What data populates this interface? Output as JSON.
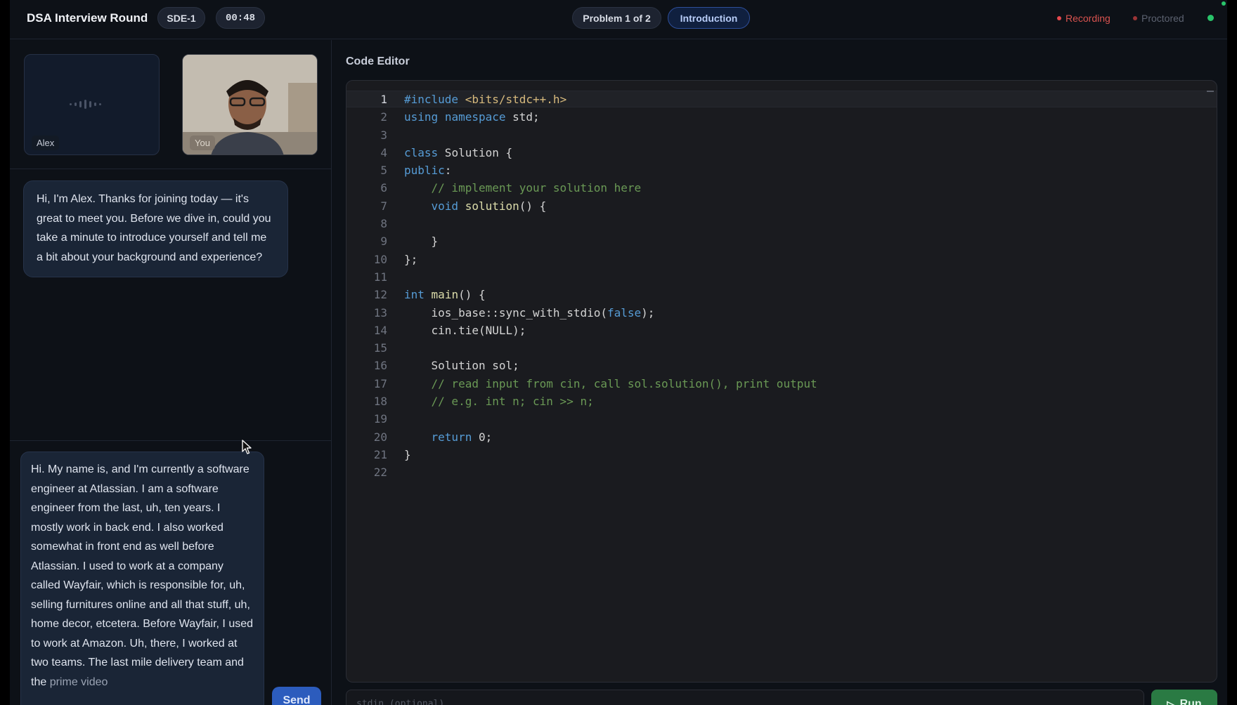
{
  "header": {
    "title": "DSA Interview Round",
    "level": "SDE-1",
    "timer": "00:48",
    "problem": "Problem 1 of 2",
    "phase": "Introduction",
    "recording": "Recording",
    "proctored": "Proctored"
  },
  "participants": {
    "interviewer": "Alex",
    "self": "You"
  },
  "chat": {
    "ai_message": "Hi, I'm Alex. Thanks for joining today — it's great to meet you. Before we dive in, could you take a minute to introduce yourself and tell me a bit about your background and experience?",
    "transcript": "Hi. My name is, and I'm currently a software engineer at Atlassian. I am a software engineer from the last, uh, ten years. I mostly work in back end. I also worked somewhat in front end as well before Atlassian. I used to work at a company called Wayfair, which is responsible for, uh, selling furnitures online and all that stuff, uh, home decor, etcetera. Before Wayfair, I used to work at Amazon. Uh, there, I worked at two teams. The last mile delivery team and the",
    "transcript_tail": "prime video",
    "send_label": "Send"
  },
  "editor": {
    "title": "Code Editor",
    "active_line": 1,
    "lines": [
      "#include <bits/stdc++.h>",
      "using namespace std;",
      "",
      "class Solution {",
      "public:",
      "    // implement your solution here",
      "    void solution() {",
      "",
      "    }",
      "};",
      "",
      "int main() {",
      "    ios_base::sync_with_stdio(false);",
      "    cin.tie(NULL);",
      "",
      "    Solution sol;",
      "    // read input from cin, call sol.solution(), print output",
      "    // e.g. int n; cin >> n;",
      "",
      "    return 0;",
      "}",
      ""
    ],
    "stdin_placeholder": "stdin (optional)",
    "run_label": "Run"
  },
  "colors": {
    "accent": "#2c5cbd",
    "recording": "#e5484d",
    "connected": "#29c46a",
    "run": "#2a7a43"
  }
}
